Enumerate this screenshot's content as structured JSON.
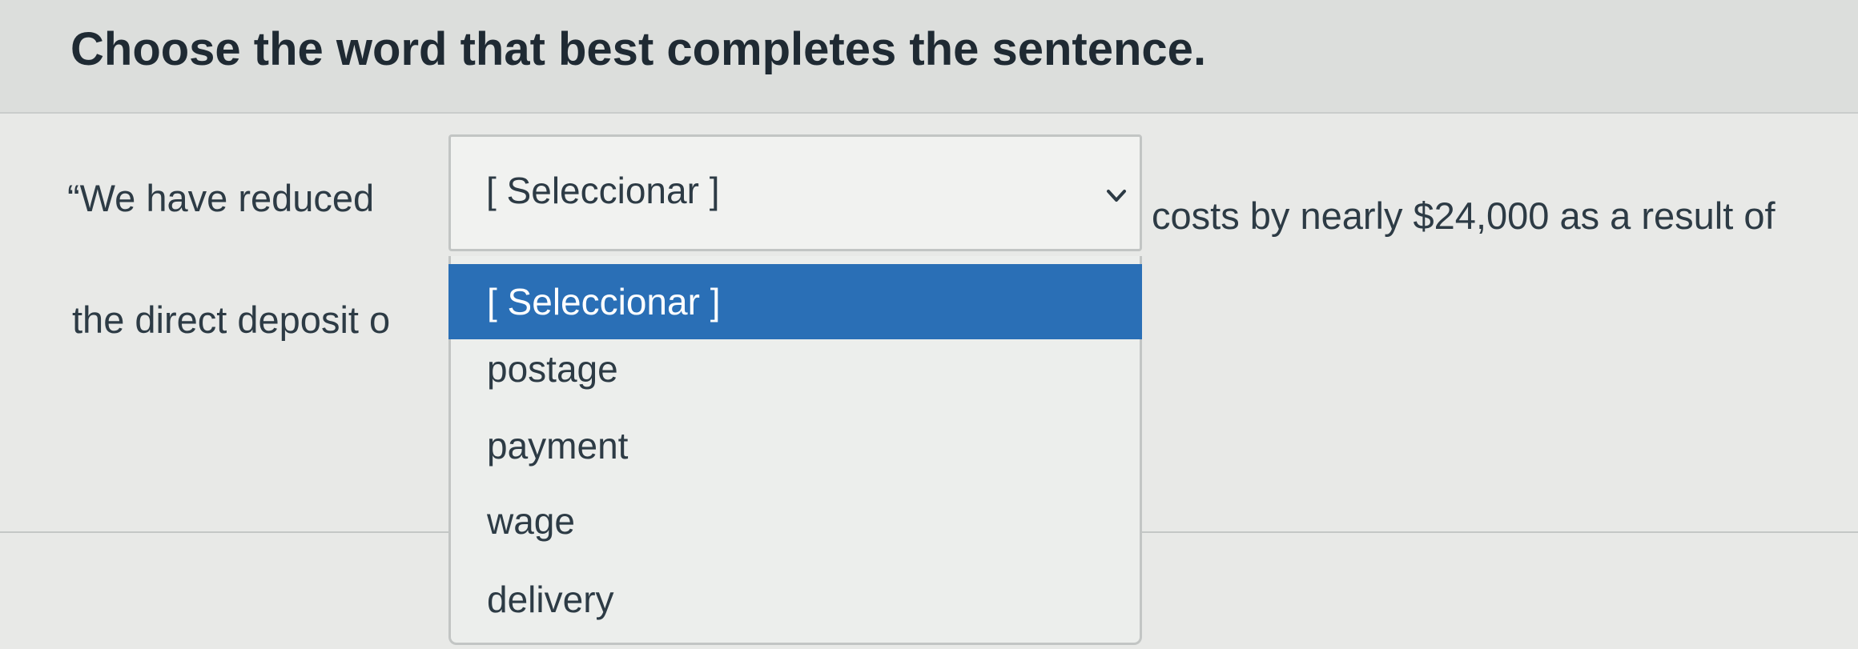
{
  "question": {
    "title": "Choose the word that best completes the sentence.",
    "sentence_start": "“We have reduced",
    "sentence_after": "costs by nearly $24,000 as a result of",
    "sentence_line2": "the direct deposit o"
  },
  "select": {
    "value": "[ Seleccionar ]",
    "chevron_icon": "chevron-down-icon",
    "options": [
      "[ Seleccionar ]",
      "postage",
      "payment",
      "wage",
      "delivery"
    ],
    "highlighted_option": "[ Seleccionar ]",
    "highlight_color": "#2a6fb6"
  }
}
